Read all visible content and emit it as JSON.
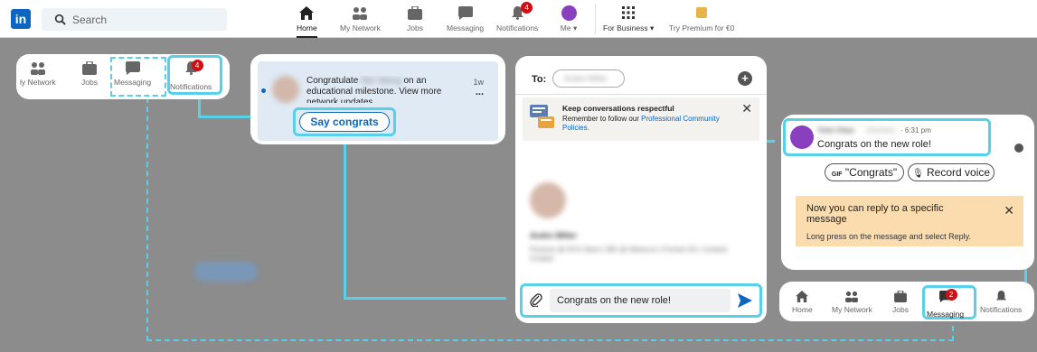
{
  "topbar": {
    "logo": "in",
    "search_placeholder": "Search",
    "nav": [
      {
        "label": "Home"
      },
      {
        "label": "My Network"
      },
      {
        "label": "Jobs"
      },
      {
        "label": "Messaging"
      },
      {
        "label": "Notifications",
        "badge": "4"
      },
      {
        "label": "Me ▾"
      },
      {
        "label": "For Business ▾"
      },
      {
        "label": "Try Premium for €0"
      }
    ]
  },
  "panel1": {
    "nav": [
      "ly Network",
      "Jobs",
      "Messaging",
      "Notifications"
    ],
    "notif_badge": "4"
  },
  "panel2": {
    "text_before": "Congratulate",
    "blurred_name": "Ilan Wang",
    "text_after": "on an educational milestone. View more network updates.",
    "time": "1w",
    "more": "...",
    "button": "Say congrats"
  },
  "panel3": {
    "to_label": "To:",
    "recipient_chip": "Andre Miller",
    "banner_title": "Keep conversations respectful",
    "banner_text_prefix": "Remember to follow our",
    "banner_link": "Professional Community Policies.",
    "profile_name": "Andre Miller",
    "profile_headline": "Finance @ NYU Stern | BD @ Aldora.io | Former EA, Content Creator",
    "composer_text": "Congrats on the new role!"
  },
  "panel4": {
    "sender_name": "Yixin Chen",
    "sender_meta": "(He/Him)",
    "time": "· 6:31 pm",
    "message": "Congrats on the new role!",
    "gif_label": "GIF",
    "gif_text": "\"Congrats\"",
    "record_text": "Record voice",
    "tip_title": "Now you can reply to a specific message",
    "tip_body": "Long press on the message and select Reply."
  },
  "panel5": {
    "nav": [
      "Home",
      "My Network",
      "Jobs",
      "Messaging",
      "Notifications"
    ],
    "msg_badge": "2"
  }
}
